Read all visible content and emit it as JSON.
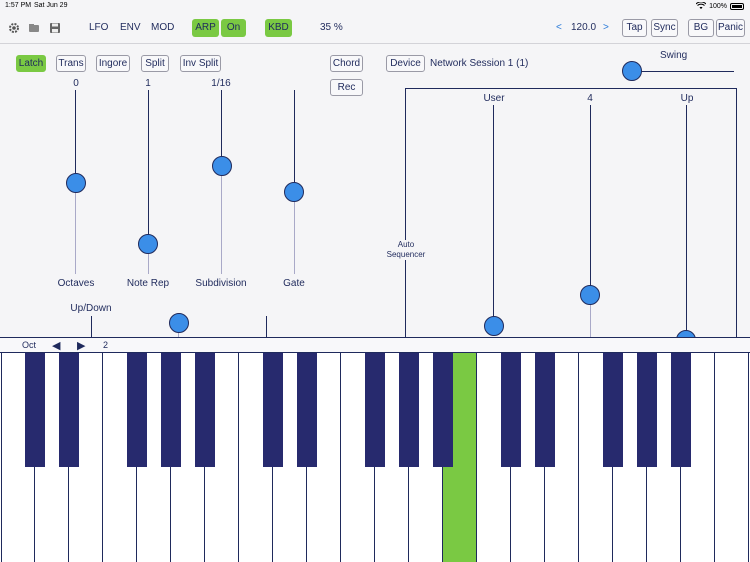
{
  "status": {
    "time": "1:57 PM",
    "date": "Sat Jun 29",
    "battery": "100%"
  },
  "toolbar": {
    "icons": [
      "gear-icon",
      "folder-icon",
      "save-icon"
    ],
    "lfo": "LFO",
    "env": "ENV",
    "mod": "MOD",
    "arp": "ARP",
    "on": "On",
    "kbd": "KBD",
    "volume": "35 %",
    "tempo_prev": "<",
    "tempo": "120.0",
    "tempo_next": ">",
    "tap": "Tap",
    "sync": "Sync",
    "bg": "BG",
    "panic": "Panic"
  },
  "arp": {
    "latch": "Latch",
    "trans": "Trans",
    "ingore": "Ingore",
    "split": "Split",
    "inv_split": "Inv Split",
    "chord": "Chord",
    "rec": "Rec",
    "device": "Device",
    "network": "Network Session 1 (1)",
    "swing": "Swing",
    "sliders": [
      {
        "name": "Octaves",
        "value": "0"
      },
      {
        "name": "Note Rep",
        "value": "1"
      },
      {
        "name": "Subdivision",
        "value": "1/16"
      },
      {
        "name": "Gate",
        "value": ""
      }
    ],
    "up_down": "Up/Down",
    "auto_sequencer": "Auto Sequencer",
    "seq_sliders": [
      {
        "value": "User"
      },
      {
        "value": "4"
      },
      {
        "value": "Up"
      }
    ]
  },
  "keyboard": {
    "oct_label": "Oct",
    "prev": "◀",
    "next": "▶",
    "octave": "2",
    "pressed_key": 13
  },
  "colors": {
    "accent_green": "#7ac943",
    "knob_blue": "#3b8ee8",
    "navy": "#1f2a5c"
  }
}
